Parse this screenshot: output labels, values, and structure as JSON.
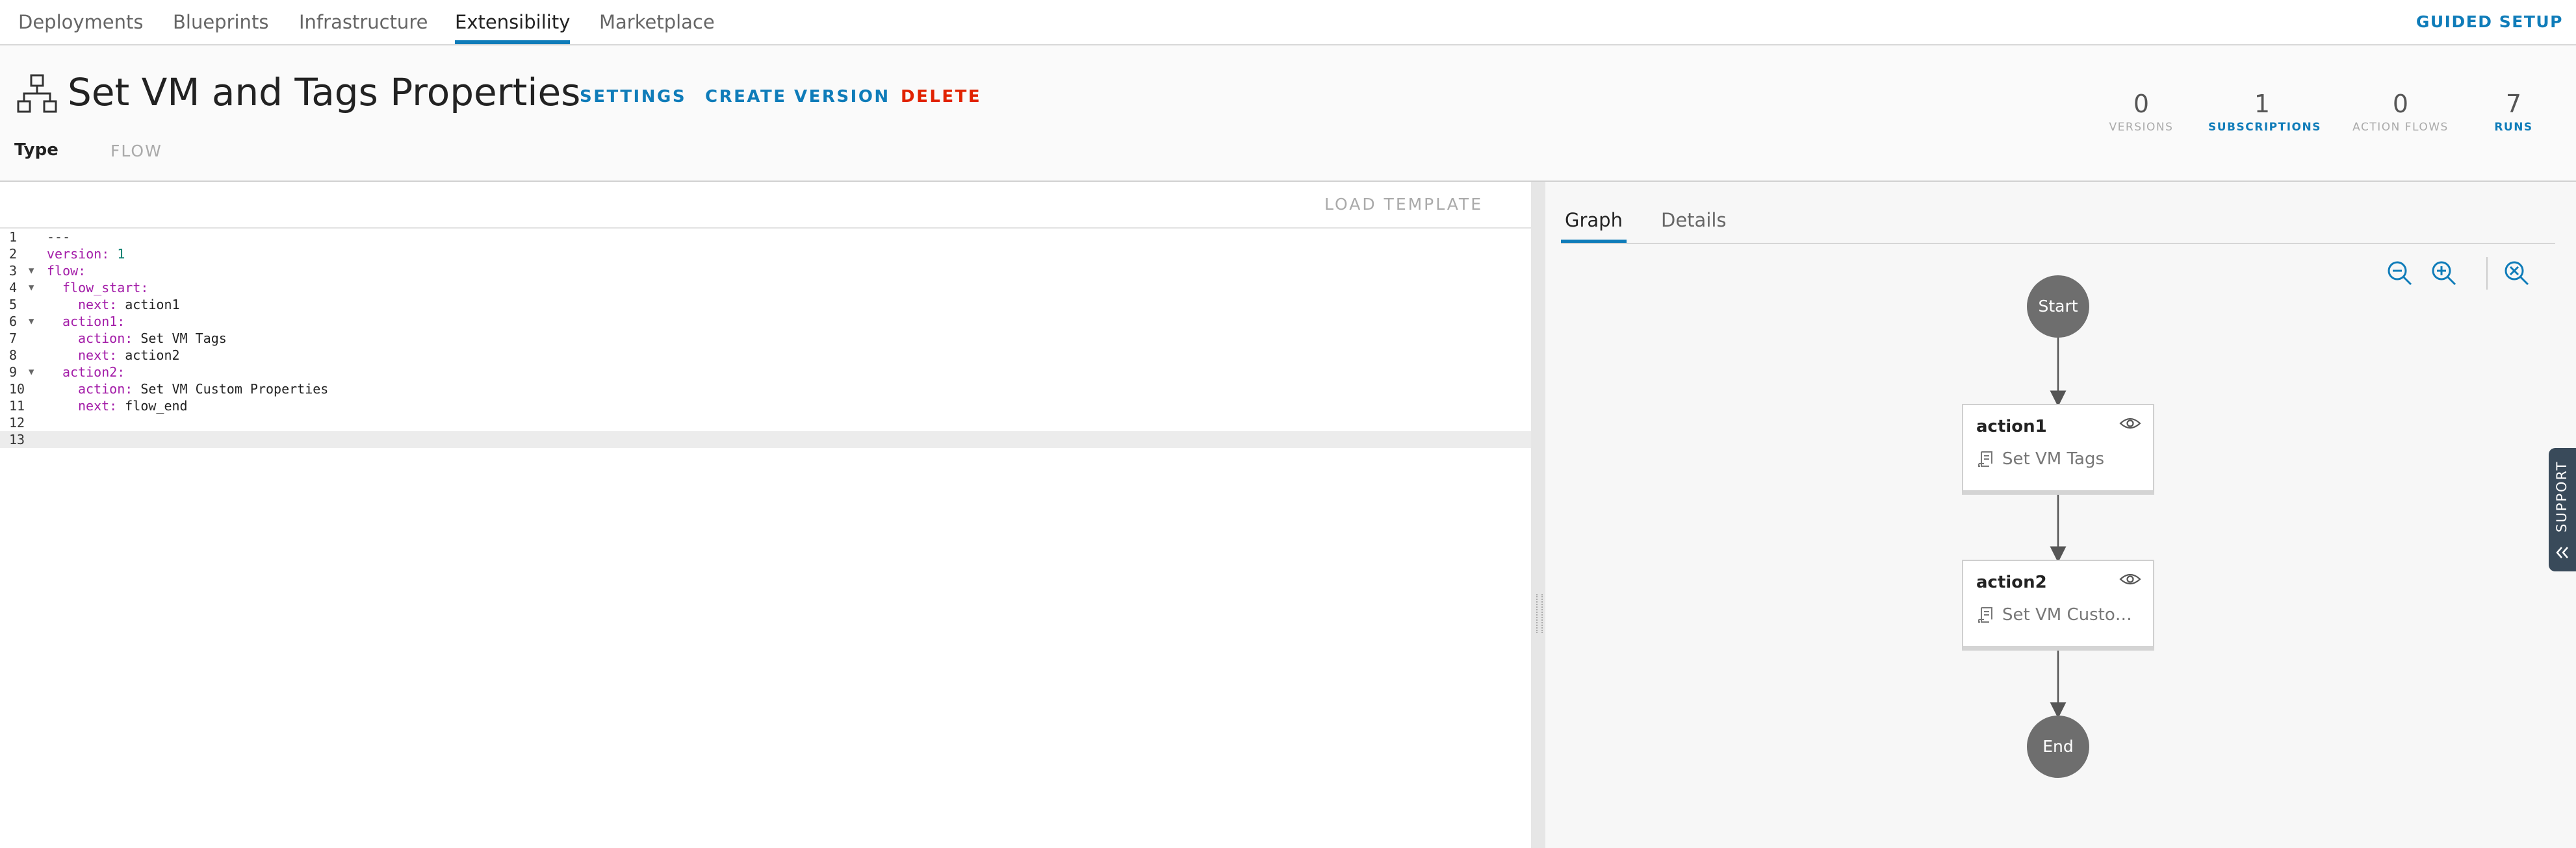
{
  "nav": {
    "tabs": [
      {
        "label": "Deployments"
      },
      {
        "label": "Blueprints"
      },
      {
        "label": "Infrastructure"
      },
      {
        "label": "Extensibility"
      },
      {
        "label": "Marketplace"
      }
    ],
    "active": "Extensibility",
    "guided_setup": "GUIDED SETUP"
  },
  "header": {
    "icon": "flow-hierarchy-icon",
    "title": "Set VM and Tags Properties",
    "actions": {
      "settings": "SETTINGS",
      "create_version": "CREATE VERSION",
      "delete": "DELETE"
    },
    "type_label": "Type",
    "type_value": "FLOW",
    "stats": [
      {
        "value": "0",
        "label": "VERSIONS"
      },
      {
        "value": "1",
        "label": "SUBSCRIPTIONS"
      },
      {
        "value": "0",
        "label": "ACTION FLOWS"
      },
      {
        "value": "7",
        "label": "RUNS"
      }
    ]
  },
  "editor": {
    "load_template": "LOAD TEMPLATE",
    "lines": [
      {
        "n": "1",
        "key": "",
        "val": "---"
      },
      {
        "n": "2",
        "key": "version:",
        "val": " 1"
      },
      {
        "n": "3",
        "key": "flow:",
        "val": ""
      },
      {
        "n": "4",
        "key": "flow_start:",
        "val": ""
      },
      {
        "n": "5",
        "key": "next:",
        "val": " action1"
      },
      {
        "n": "6",
        "key": "action1:",
        "val": ""
      },
      {
        "n": "7",
        "key": "action:",
        "val": " Set VM Tags"
      },
      {
        "n": "8",
        "key": "next:",
        "val": " action2"
      },
      {
        "n": "9",
        "key": "action2:",
        "val": ""
      },
      {
        "n": "10",
        "key": "action:",
        "val": " Set VM Custom Properties"
      },
      {
        "n": "11",
        "key": "next:",
        "val": " flow_end"
      },
      {
        "n": "12",
        "key": "",
        "val": ""
      },
      {
        "n": "13",
        "key": "",
        "val": ""
      }
    ]
  },
  "graph": {
    "tabs": [
      {
        "label": "Graph"
      },
      {
        "label": "Details"
      }
    ],
    "active": "Graph",
    "nodes": {
      "start": "Start",
      "action1": {
        "name": "action1",
        "action": "Set VM Tags"
      },
      "action2": {
        "name": "action2",
        "action": "Set VM Custom..."
      },
      "end": "End"
    },
    "icons": [
      "zoom-out-icon",
      "zoom-in-icon",
      "zoom-reset-icon",
      "eye-icon",
      "action-script-icon"
    ]
  },
  "support": {
    "label": "SUPPORT"
  },
  "colors": {
    "accent": "#0f7cb9",
    "danger": "#e12200",
    "yaml_key": "#a31ca8",
    "node": "#6e6e6e",
    "support_bg": "#394a5a"
  }
}
